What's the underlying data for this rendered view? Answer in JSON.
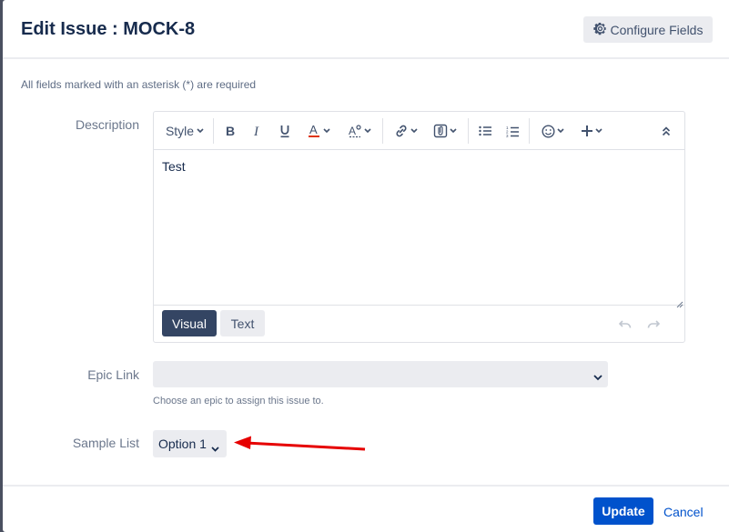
{
  "dialog": {
    "title": "Edit Issue : MOCK-8",
    "configure_fields_label": "Configure Fields",
    "required_note": "All fields marked with an asterisk (*) are required"
  },
  "description": {
    "label": "Description",
    "toolbar": {
      "style_label": "Style",
      "icons": [
        "bold-icon",
        "italic-icon",
        "underline-icon",
        "text-color-icon",
        "text-format-icon",
        "link-icon",
        "attachment-icon",
        "bullet-list-icon",
        "numbered-list-icon",
        "emoji-icon",
        "insert-more-icon",
        "collapse-toolbar-icon"
      ],
      "text_color_accent": "#de350b"
    },
    "content": "Test",
    "modes": {
      "visual_label": "Visual",
      "text_label": "Text",
      "active": "Visual"
    }
  },
  "epic_link": {
    "label": "Epic Link",
    "value": "",
    "help_text": "Choose an epic to assign this issue to."
  },
  "sample_list": {
    "label": "Sample List",
    "value": "Option 1"
  },
  "footer": {
    "update_label": "Update",
    "cancel_label": "Cancel"
  },
  "colors": {
    "primary": "#0052cc",
    "annotation_arrow": "#e60000"
  }
}
